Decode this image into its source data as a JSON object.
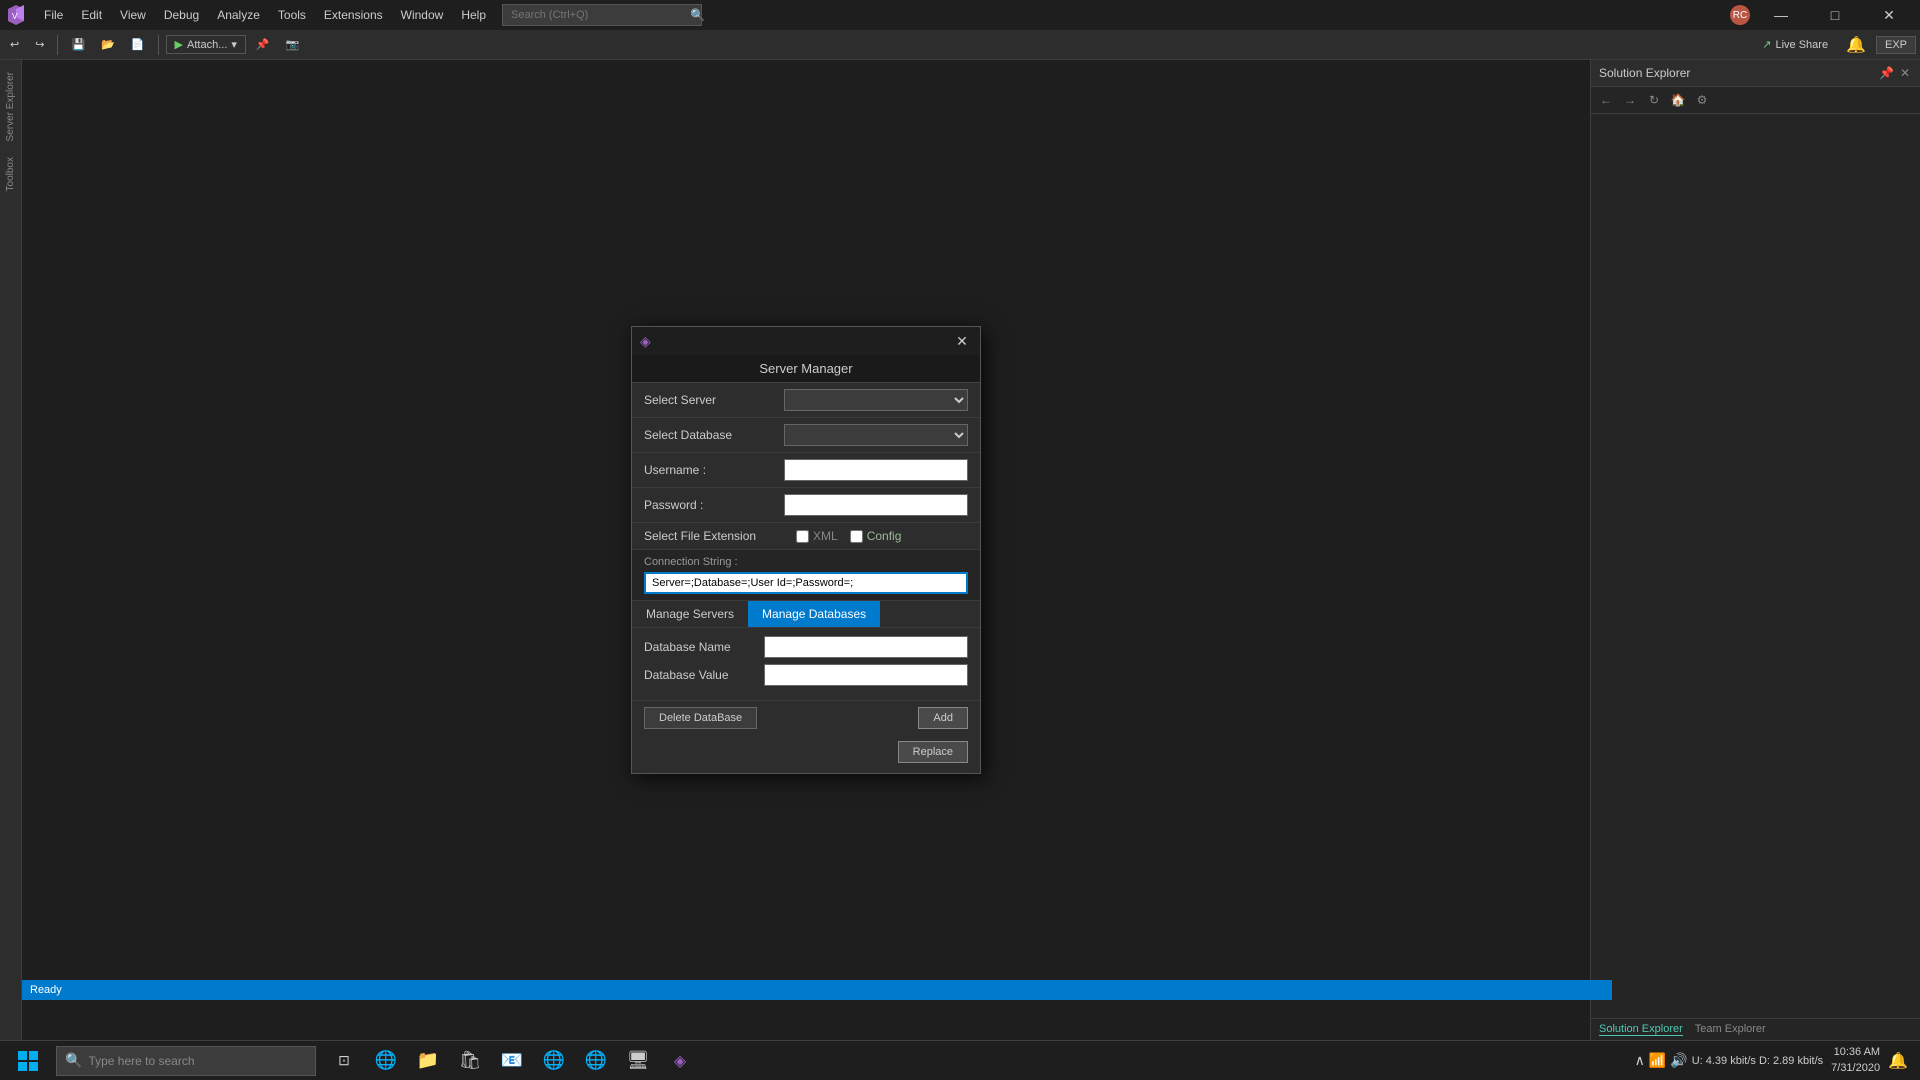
{
  "titlebar": {
    "app_name": "Visual Studio",
    "menu_items": [
      "File",
      "Edit",
      "View",
      "Debug",
      "Analyze",
      "Tools",
      "Extensions",
      "Window",
      "Help"
    ],
    "search_placeholder": "Search (Ctrl+Q)",
    "window_controls": {
      "minimize": "—",
      "maximize": "□",
      "close": "✕"
    }
  },
  "toolbar": {
    "attach_label": "Attach...",
    "live_share_label": "Live Share",
    "exp_label": "EXP"
  },
  "left_tabs": {
    "items": [
      "Server Explorer",
      "Toolbox"
    ]
  },
  "solution_explorer": {
    "title": "Solution Explorer",
    "tabs": [
      {
        "label": "Solution Explorer",
        "active": true
      },
      {
        "label": "Team Explorer",
        "active": false
      }
    ]
  },
  "server_manager": {
    "title": "Server Manager",
    "vs_icon": "◈",
    "select_server_label": "Select Server",
    "select_database_label": "Select Database",
    "username_label": "Username :",
    "password_label": "Password :",
    "file_ext_label": "Select File Extension",
    "xml_label": "XML",
    "config_label": "Config",
    "connection_string_label": "Connection String :",
    "connection_string_value": "Server=;Database=;User Id=;Password=;",
    "tabs": [
      {
        "label": "Manage Servers",
        "active": false
      },
      {
        "label": "Manage Databases",
        "active": true
      }
    ],
    "db_name_label": "Database Name",
    "db_value_label": "Database Value",
    "delete_btn": "Delete DataBase",
    "add_btn": "Add",
    "replace_btn": "Replace",
    "close_icon": "✕"
  },
  "status_bar": {
    "ready_label": "Ready"
  },
  "taskbar": {
    "search_placeholder": "Type here to search",
    "search_icon": "🔍",
    "time": "10:36 AM",
    "date": "7/31/2020",
    "network": "U: 4.39 kbit/s\nD: 2.89 kbit/s",
    "apps": [
      "⊞",
      "⬡",
      "🌐",
      "📁",
      "🛍",
      "📧",
      "🌐",
      "🌐",
      "🖥",
      "🔷"
    ]
  }
}
